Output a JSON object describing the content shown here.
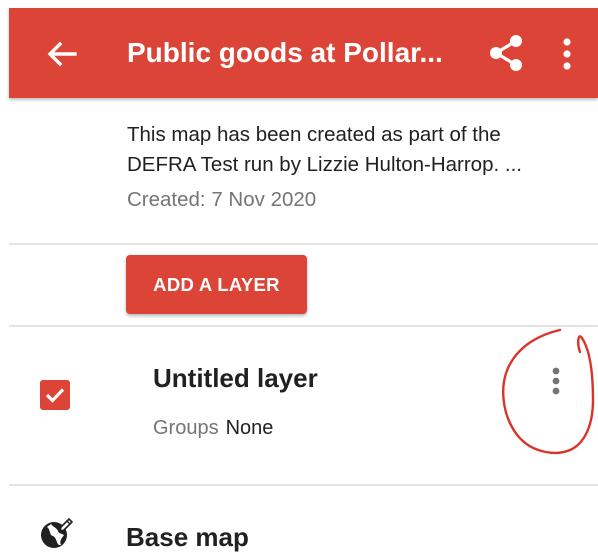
{
  "toolbar": {
    "title": "Public goods at Pollar...",
    "back_icon": "arrow-back-icon",
    "share_icon": "share-icon",
    "more_icon": "more-vert-icon",
    "color": "#db4437"
  },
  "map_info": {
    "description_line1": "This map has been created as part of the",
    "description_line2": "DEFRA Test run by Lizzie Hulton-Harrop. ...",
    "created": "Created: 7 Nov 2020"
  },
  "add_layer": {
    "label": "ADD A LAYER"
  },
  "layer": {
    "name": "Untitled layer",
    "checked": true,
    "groups_label": "Groups",
    "groups_value": "None",
    "more_icon": "more-vert-icon"
  },
  "base_map": {
    "label": "Base map",
    "icon": "globe-edit-icon"
  }
}
